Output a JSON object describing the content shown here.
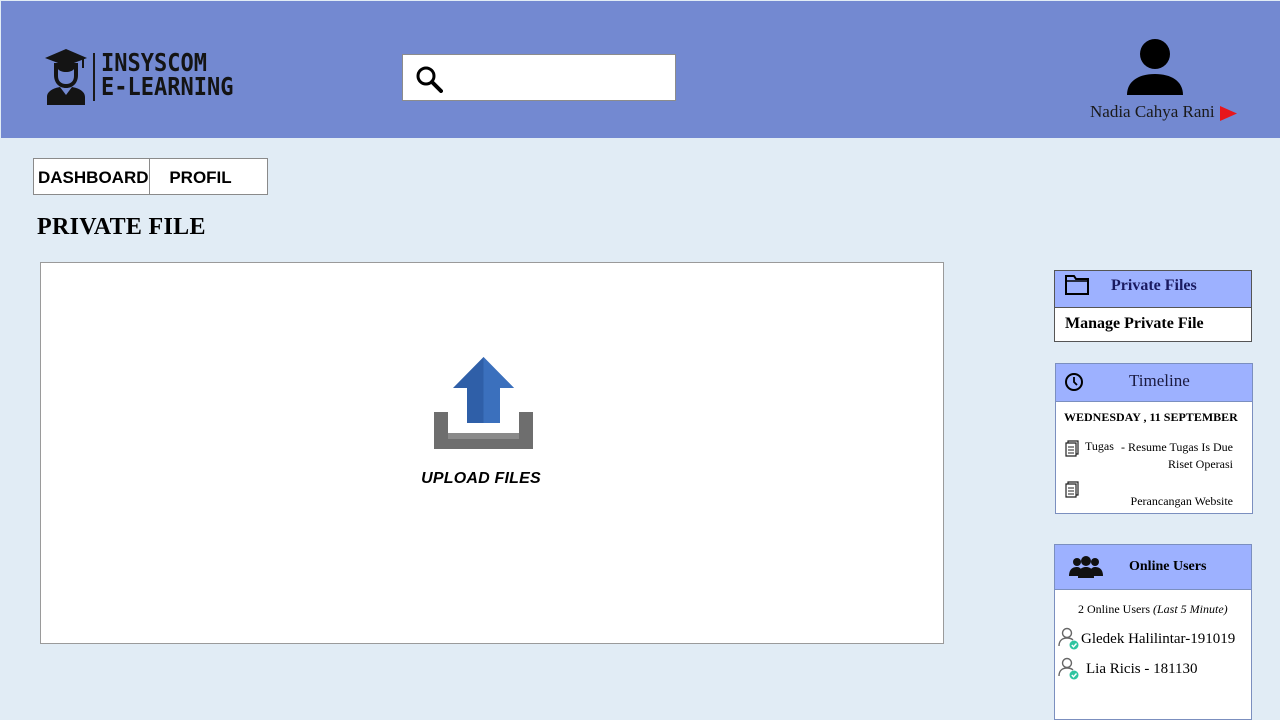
{
  "app": {
    "logo_line1": "INSYSCOM",
    "logo_line2": "E-LEARNING"
  },
  "search": {
    "value": "",
    "placeholder": ""
  },
  "user": {
    "name": "Nadia Cahya Rani"
  },
  "nav": {
    "tabs": [
      "DASHBOARD",
      "PROFIL"
    ]
  },
  "page": {
    "title": "PRIVATE FILE"
  },
  "upload": {
    "label": "UPLOAD FILES"
  },
  "sidebar": {
    "private_files": {
      "title": "Private Files",
      "link": "Manage Private File"
    },
    "timeline": {
      "title": "Timeline",
      "date": "WEDNESDAY , 11 SEPTEMBER",
      "events": [
        {
          "type": "Tugas",
          "description_line1": "- Resume Tugas Is Due",
          "description_line2": "Riset Operasi"
        },
        {
          "type": "",
          "description_line1": "Perancangan Website"
        }
      ]
    },
    "online_users": {
      "title": "Online Users",
      "summary_count": "2 Online Users",
      "summary_window": "(Last 5 Minute)",
      "users": [
        "Gledek Halilintar-191019",
        "Lia Ricis - 181130"
      ]
    }
  },
  "colors": {
    "header_bg": "#7389d1",
    "page_bg": "#e1ecf5",
    "card_header_bg": "#9db1ff",
    "arrow_red": "#e8161b",
    "upload_blue": "#2f5fa8",
    "online_check": "#2ec4a0"
  }
}
